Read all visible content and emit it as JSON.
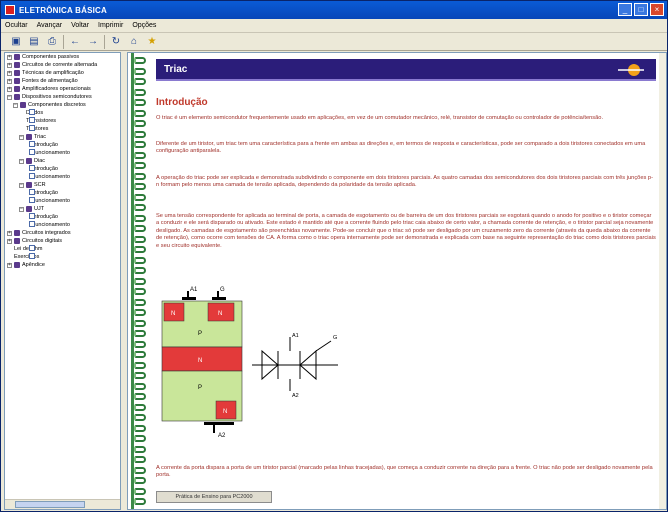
{
  "window": {
    "title": "ELETRÔNICA BÁSICA"
  },
  "menu": [
    "Ocultar",
    "Avançar",
    "Voltar",
    "Imprimir",
    "Opções"
  ],
  "toolbar": {
    "icons": [
      "hide-icon",
      "save-icon",
      "print-icon",
      "back-icon",
      "forward-icon",
      "refresh-icon",
      "home-icon",
      "favorites-icon"
    ]
  },
  "tree": [
    {
      "label": "Componentes passivos",
      "level": 0,
      "kind": "book",
      "open": false
    },
    {
      "label": "Circuitos de corrente alternada",
      "level": 0,
      "kind": "book",
      "open": false
    },
    {
      "label": "Técnicas de amplificação",
      "level": 0,
      "kind": "book",
      "open": false
    },
    {
      "label": "Fontes de alimentação",
      "level": 0,
      "kind": "book",
      "open": false
    },
    {
      "label": "Amplificadores operacionais",
      "level": 0,
      "kind": "book",
      "open": false
    },
    {
      "label": "Dispositivos semicondutores",
      "level": 0,
      "kind": "book",
      "open": true
    },
    {
      "label": "Componentes discretos",
      "level": 1,
      "kind": "book",
      "open": true
    },
    {
      "label": "Diodos",
      "level": 2,
      "kind": "page"
    },
    {
      "label": "Transistores",
      "level": 2,
      "kind": "page"
    },
    {
      "label": "Tiristores",
      "level": 2,
      "kind": "page"
    },
    {
      "label": "Triac",
      "level": 2,
      "kind": "book",
      "open": true
    },
    {
      "label": "Introdução",
      "level": 3,
      "kind": "page"
    },
    {
      "label": "Funcionamento",
      "level": 3,
      "kind": "page"
    },
    {
      "label": "Diac",
      "level": 2,
      "kind": "book",
      "open": true
    },
    {
      "label": "Introdução",
      "level": 3,
      "kind": "page"
    },
    {
      "label": "Funcionamento",
      "level": 3,
      "kind": "page"
    },
    {
      "label": "SCR",
      "level": 2,
      "kind": "book",
      "open": true
    },
    {
      "label": "Introdução",
      "level": 3,
      "kind": "page"
    },
    {
      "label": "Funcionamento",
      "level": 3,
      "kind": "page"
    },
    {
      "label": "UJT",
      "level": 2,
      "kind": "book",
      "open": true
    },
    {
      "label": "Introdução",
      "level": 3,
      "kind": "page"
    },
    {
      "label": "Funcionamento",
      "level": 3,
      "kind": "page"
    },
    {
      "label": "Circuitos integrados",
      "level": 0,
      "kind": "book",
      "open": false
    },
    {
      "label": "Circuitos digitais",
      "level": 0,
      "kind": "book",
      "open": false
    },
    {
      "label": "Lei de Ohm",
      "level": 0,
      "kind": "page"
    },
    {
      "label": "Exercícios",
      "level": 0,
      "kind": "page"
    },
    {
      "label": "Apêndice",
      "level": 0,
      "kind": "book",
      "open": false
    }
  ],
  "content": {
    "banner_title": "Triac",
    "heading": "Introdução",
    "paragraphs": [
      "O triac é um elemento semicondutor frequentemente usado em aplicações, em vez de um comutador mecânico, relé, transistor de comutação ou controlador de potência/tensão.",
      "Diferente de um tiristor, um triac tem uma característica para a frente em ambas as direções e, em termos de resposta e características, pode ser comparado a dois tiristores conectados em uma configuração antiparalela.",
      "A operação do triac pode ser explicada e demonstrada subdividindo o componente em dois tiristores parciais. As quatro camadas dos semicondutores dos dois tiristores parciais com três junções p-n formam pelo menos uma camada de tensão aplicada, dependendo da polaridade da tensão aplicada.",
      "Se uma tensão correspondente for aplicada ao terminal de porta, a camada de esgotamento ou de barreira de um dos tiristores parciais se esgotará quando o anodo for positivo e o tiristor começar a conduzir e ele será disparado ou ativado. Este estado é mantido até que a corrente fluindo pelo triac caia abaixo de certo valor, a chamada corrente de retenção, e o tiristor parcial seja novamente desligado. As camadas de esgotamento são preenchidas novamente. Pode-se concluir que o triac só pode ser desligado por um cruzamento zero da corrente (através da queda abaixo da corrente de retenção), como ocorre com tensões de CA. A forma como o triac opera internamente pode ser demonstrada e explicada com base na seguinte representação do triac como dois tiristores parciais e seu circuito equivalente."
    ],
    "diagram_labels": {
      "a1": "A1",
      "g": "G",
      "a2": "A2",
      "n1": "N",
      "n2": "N",
      "p1": "P",
      "n_mid": "N",
      "p2": "P",
      "n3": "N"
    },
    "caption": "A corrente da porta dispara a porta de um tiristor parcial (marcado pelas linhas tracejadas), que começa a conduzir corrente na direção para a frente. O triac não pode ser desligado novamente pela porta.",
    "button_label": "Prática de Ensino para PC2000"
  }
}
